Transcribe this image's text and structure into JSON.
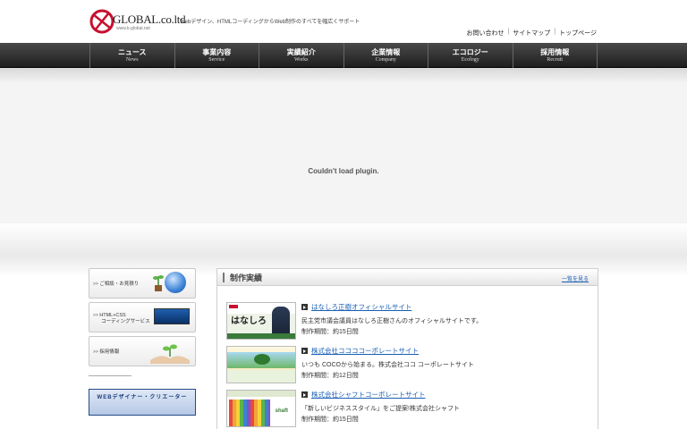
{
  "header": {
    "logo_text": "GLOBAL.co.ltd",
    "logo_sub": "www.k-global.net",
    "tagline": "Webデザイン、HTMLコーディングからWeb制作のすべてを幅広くサポート",
    "util_nav": [
      "お問い合わせ",
      "サイトマップ",
      "トップページ"
    ]
  },
  "gnav": [
    {
      "jp": "ニュース",
      "en": "News"
    },
    {
      "jp": "事業内容",
      "en": "Service"
    },
    {
      "jp": "実績紹介",
      "en": "Works"
    },
    {
      "jp": "企業情報",
      "en": "Company"
    },
    {
      "jp": "エコロジー",
      "en": "Ecology"
    },
    {
      "jp": "採用情報",
      "en": "Recruit"
    }
  ],
  "plugin": {
    "message": "Couldn't load plugin."
  },
  "sidebar": {
    "banners": [
      {
        "label": "ご相談・お見積り"
      },
      {
        "label_line1": "HTML+CSS",
        "label_line2": "コーディングサービス"
      },
      {
        "label": "採用情報"
      }
    ],
    "recruit_banner": "WEBデザイナー・クリエーター"
  },
  "works": {
    "title": "制作実績",
    "more": "一覧を見る",
    "items": [
      {
        "title": "はなしろ正樹オフィシャルサイト",
        "desc": "民主党市議会議員はなしろ正樹さんのオフィシャルサイトです。",
        "period": "制作期間：約15日間",
        "thumb_text": "はなしろ"
      },
      {
        "title": "株式会社ココココーポレートサイト",
        "desc": "いつも COCOから始まる。株式会社ココ コーポレートサイト",
        "period": "制作期間：約12日間",
        "thumb_text": ""
      },
      {
        "title": "株式会社シャフトコーポレートサイト",
        "desc": "「新しいビジネススタイル」をご提案!株式会社シャフト",
        "period": "制作期間：約15日間",
        "thumb_text": "shaft"
      }
    ]
  },
  "colors": {
    "nav_bg": "#2a2a2a",
    "link": "#1a5fb4",
    "logo_red": "#c8102e"
  }
}
